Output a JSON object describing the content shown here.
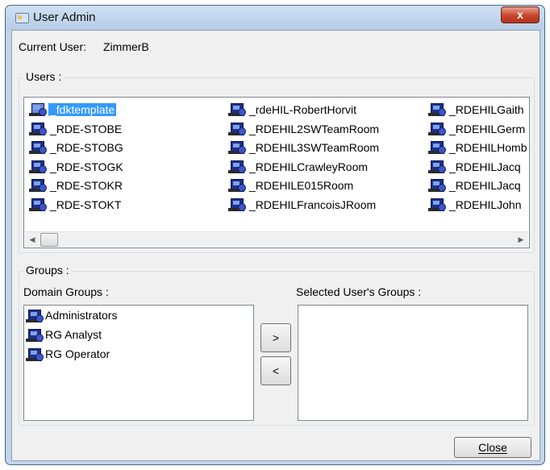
{
  "window": {
    "title": "User Admin",
    "close_glyph": "x"
  },
  "current_user": {
    "label": "Current User:",
    "value": "ZimmerB"
  },
  "users": {
    "legend": "Users :",
    "items": [
      {
        "label": "_fdktemplate",
        "selected": true
      },
      {
        "label": "_RDE-STOBE"
      },
      {
        "label": "_RDE-STOBG"
      },
      {
        "label": "_RDE-STOGK"
      },
      {
        "label": "_RDE-STOKR"
      },
      {
        "label": "_RDE-STOKT"
      },
      {
        "label": "_rdeHIL-RobertHorvit"
      },
      {
        "label": "_RDEHIL2SWTeamRoom"
      },
      {
        "label": "_RDEHIL3SWTeamRoom"
      },
      {
        "label": "_RDEHILCrawleyRoom"
      },
      {
        "label": "_RDEHILE015Room"
      },
      {
        "label": "_RDEHILFrancoisJRoom"
      },
      {
        "label": "_RDEHILGaith"
      },
      {
        "label": "_RDEHILGerm"
      },
      {
        "label": "_RDEHILHomb"
      },
      {
        "label": "_RDEHILJacq"
      },
      {
        "label": "_RDEHILJacq"
      },
      {
        "label": "_RDEHILJohn"
      }
    ],
    "scroll_left_glyph": "◀",
    "scroll_right_glyph": "▶"
  },
  "groups": {
    "legend": "Groups :",
    "domain_label": "Domain Groups :",
    "selected_label": "Selected User's Groups :",
    "domain_items": [
      "Administrators",
      "RG Analyst",
      "RG Operator"
    ],
    "selected_items": [],
    "add_label": ">",
    "remove_label": "<"
  },
  "footer": {
    "close_label": "Close"
  }
}
